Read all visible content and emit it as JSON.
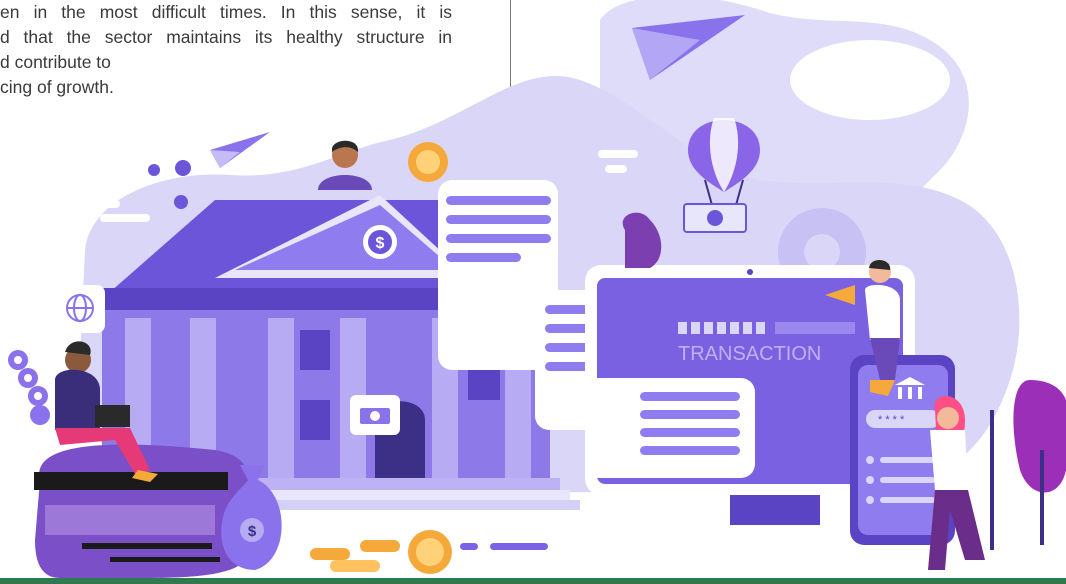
{
  "article": {
    "lines": [
      "en in the most difficult times.  In this sense, it is",
      "d that the sector maintains its healthy structure in",
      "d contribute to",
      "cing of growth."
    ]
  },
  "illustration": {
    "monitor_label": "TRANSACTION",
    "phone_pin": "* * * *",
    "icons": [
      "bank-icon",
      "dollar-coin-icon",
      "paper-plane-icon",
      "hot-air-balloon-icon",
      "globe-icon",
      "money-bag-icon",
      "megaphone-icon",
      "gear-icon"
    ],
    "colors": {
      "primary": "#7d62e6",
      "light": "#d7d3f7",
      "dark": "#3c2f86",
      "accent_orange": "#f6a93b",
      "accent_pink": "#ff4f86",
      "bottom_bar": "#2f7a4f"
    }
  }
}
